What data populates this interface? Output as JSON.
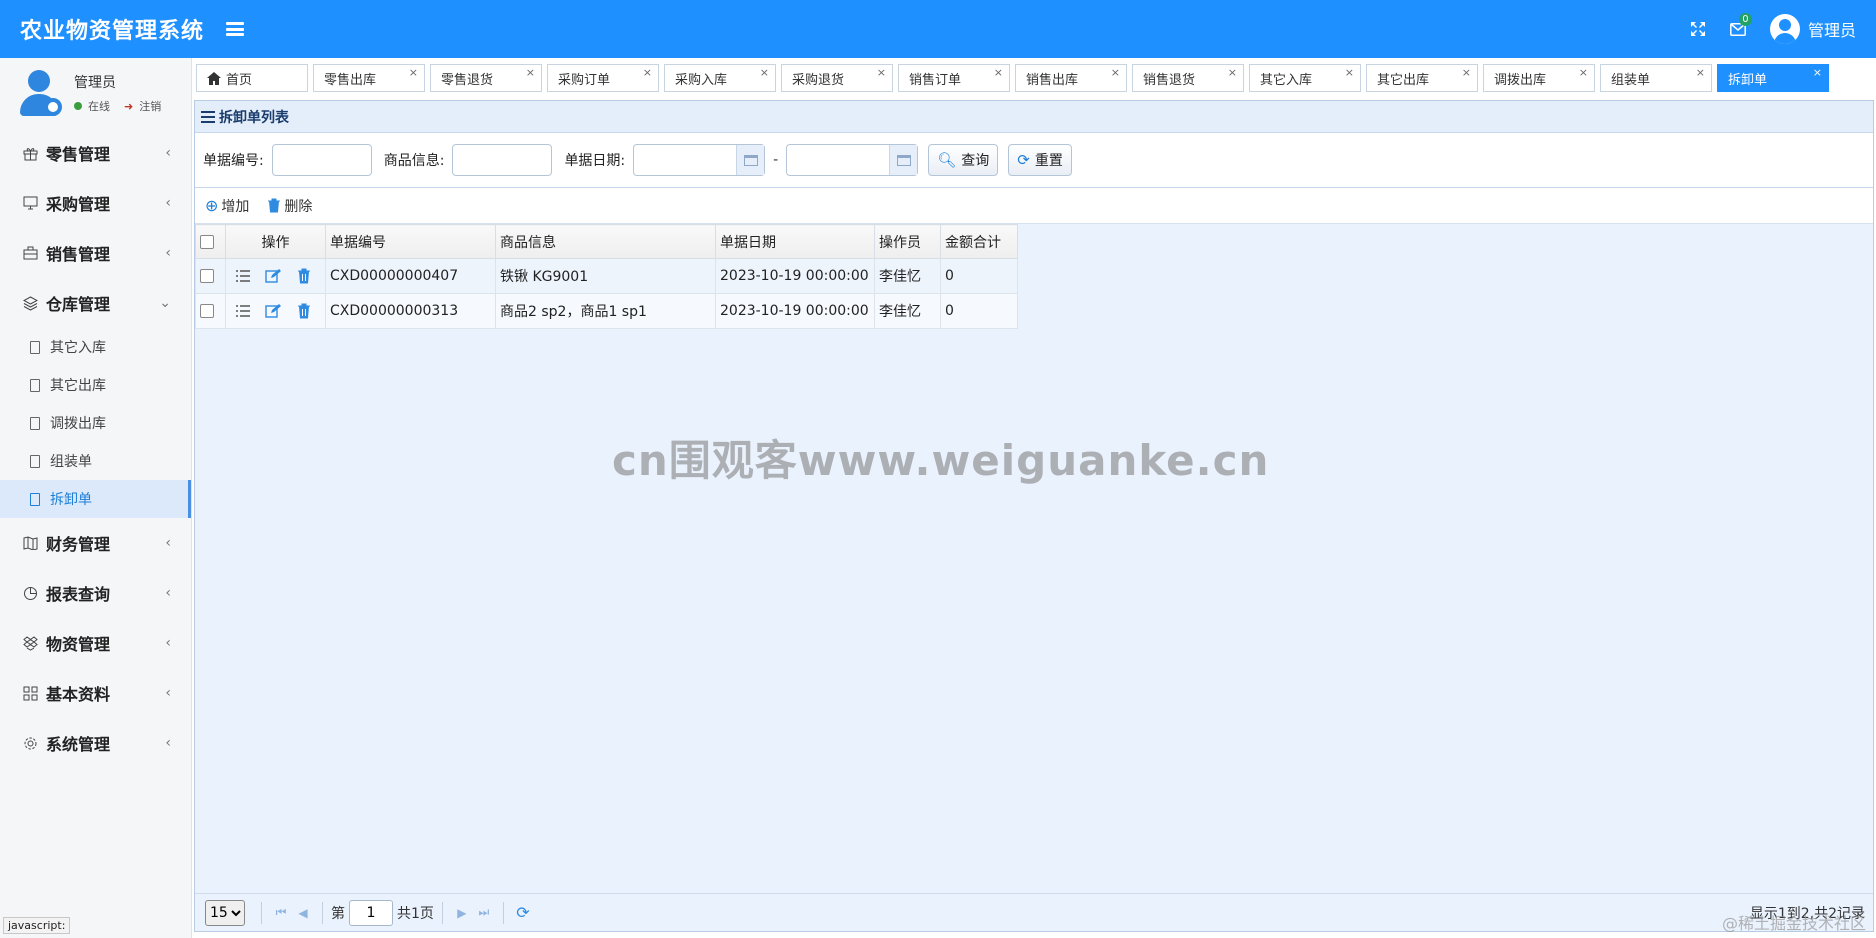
{
  "header": {
    "title": "农业物资管理系统",
    "username": "管理员",
    "mail_badge": "0"
  },
  "user_panel": {
    "name": "管理员",
    "status": "在线",
    "logout": "注销"
  },
  "sidebar": {
    "groups": [
      {
        "label": "零售管理",
        "icon": "gift-icon"
      },
      {
        "label": "采购管理",
        "icon": "monitor-icon"
      },
      {
        "label": "销售管理",
        "icon": "briefcase-icon"
      },
      {
        "label": "仓库管理",
        "icon": "layers-icon",
        "expanded": true
      },
      {
        "label": "财务管理",
        "icon": "map-icon"
      },
      {
        "label": "报表查询",
        "icon": "pie-chart-icon"
      },
      {
        "label": "物资管理",
        "icon": "dropbox-icon"
      },
      {
        "label": "基本资料",
        "icon": "grid-icon"
      },
      {
        "label": "系统管理",
        "icon": "gear-icon"
      }
    ],
    "warehouse_items": [
      "其它入库",
      "其它出库",
      "调拨出库",
      "组装单",
      "拆卸单"
    ]
  },
  "tabs": [
    "首页",
    "零售出库",
    "零售退货",
    "采购订单",
    "采购入库",
    "采购退货",
    "销售订单",
    "销售出库",
    "销售退货",
    "其它入库",
    "其它出库",
    "调拨出库",
    "组装单",
    "拆卸单"
  ],
  "panel": {
    "title": "拆卸单列表"
  },
  "search": {
    "code_label": "单据编号:",
    "goods_label": "商品信息:",
    "date_label": "单据日期:",
    "dash": "-",
    "query_btn": "查询",
    "reset_btn": "重置"
  },
  "toolbar": {
    "add": "增加",
    "delete": "删除"
  },
  "table": {
    "headers": [
      "操作",
      "单据编号",
      "商品信息",
      "单据日期",
      "操作员",
      "金额合计"
    ],
    "rows": [
      {
        "code": "CXD00000000407",
        "goods": "铁锹 KG9001",
        "date": "2023-10-19 00:00:00",
        "operator": "李佳忆",
        "amount": "0"
      },
      {
        "code": "CXD00000000313",
        "goods": "商品2 sp2，商品1 sp1",
        "date": "2023-10-19 00:00:00",
        "operator": "李佳忆",
        "amount": "0"
      }
    ]
  },
  "watermark": "cn围观客www.weiguanke.cn",
  "pager": {
    "page_size": "15",
    "page_prefix": "第",
    "page_value": "1",
    "page_suffix": "共1页",
    "info": "显示1到2,共2记录"
  },
  "status_tip": "javascript:",
  "footer_watermark": "@稀土掘金技术社区"
}
